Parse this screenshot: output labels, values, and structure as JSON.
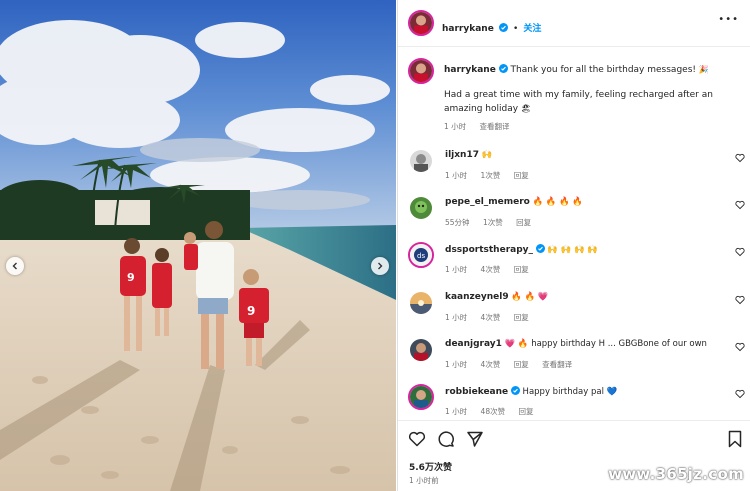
{
  "post": {
    "author": "harrykane",
    "follow_label": "关注",
    "more_label": "•••",
    "caption_line1": "Thank you for all the birthday messages!",
    "caption_emoji1": "🎉",
    "caption_line2": "Had a great time with my family, feeling recharged after an amazing holiday",
    "caption_emoji2": "🏖",
    "caption_time": "1 小时",
    "caption_translate": "查看翻译"
  },
  "comments": [
    {
      "user": "iljxn17",
      "text": "🙌",
      "time": "1 小时",
      "likes": "1次赞",
      "reply": "回复",
      "verified": false
    },
    {
      "user": "pepe_el_memero",
      "text": "🔥 🔥 🔥 🔥",
      "time": "55分钟",
      "likes": "1次赞",
      "reply": "回复",
      "verified": false
    },
    {
      "user": "dssportstherapy_",
      "text": "🙌 🙌 🙌 🙌",
      "time": "1 小时",
      "likes": "4次赞",
      "reply": "回复",
      "verified": true
    },
    {
      "user": "kaanzeynel9",
      "text": "🔥 🔥 💗",
      "time": "1 小时",
      "likes": "4次赞",
      "reply": "回复",
      "verified": false
    },
    {
      "user": "deanjgray1",
      "text": "💗 🔥 happy birthday H ... GBGBone of our own",
      "time": "1 小时",
      "likes": "4次赞",
      "reply": "回复",
      "translate": "查看翻译",
      "verified": false
    },
    {
      "user": "robbiekeane",
      "text": "Happy birthday pal 💙",
      "time": "1 小时",
      "likes": "48次赞",
      "reply": "回复",
      "verified": true
    }
  ],
  "footer": {
    "likes": "5.6万次赞",
    "time": "1 小时前"
  },
  "watermark": "www.365jz.com",
  "icons": [
    "chevron-left-icon",
    "chevron-right-icon",
    "verified-badge-icon",
    "more-icon",
    "heart-icon",
    "comment-icon",
    "share-icon",
    "bookmark-icon"
  ],
  "colors": {
    "accent": "#0095f6",
    "text": "#262626",
    "muted": "#737373",
    "story_ring": "#d6249f"
  }
}
